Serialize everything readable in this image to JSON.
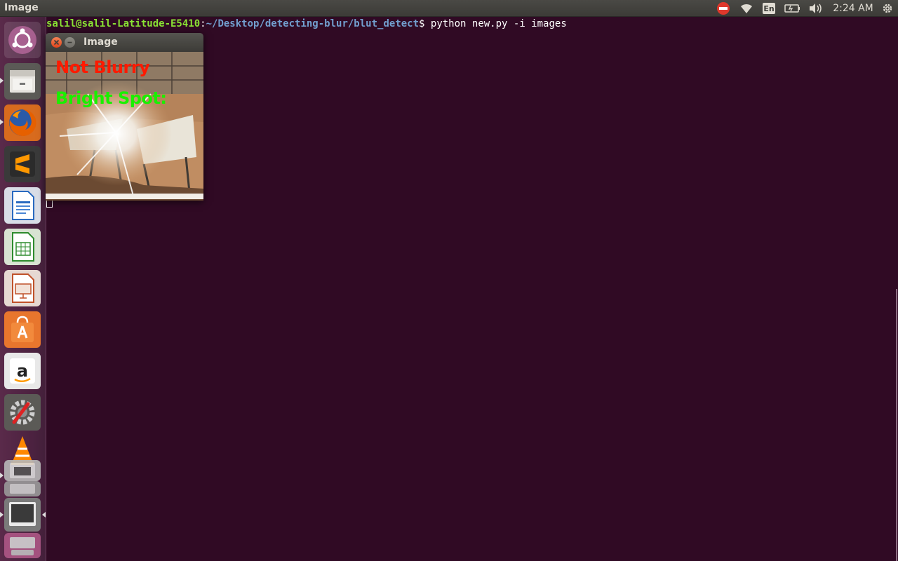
{
  "panel": {
    "title": "Image",
    "clock": "2:24 AM",
    "lang": "En"
  },
  "terminal": {
    "user_host": "salil@salil-Latitude-E5410",
    "separator": ":",
    "path": "~/Desktop/detecting-blur/blut_detect",
    "prompt_char": "$",
    "command": " python new.py -i images"
  },
  "image_window": {
    "title": "Image",
    "blur_label": "Not Blurry",
    "bright_label": "Bright Spot:"
  },
  "launcher": [
    {
      "name": "ubuntu-dash-icon"
    },
    {
      "name": "files-icon"
    },
    {
      "name": "firefox-icon"
    },
    {
      "name": "sublime-text-icon"
    },
    {
      "name": "libreoffice-writer-icon"
    },
    {
      "name": "libreoffice-calc-icon"
    },
    {
      "name": "libreoffice-impress-icon"
    },
    {
      "name": "software-center-icon"
    },
    {
      "name": "amazon-icon"
    },
    {
      "name": "system-settings-icon"
    },
    {
      "name": "vlc-icon"
    }
  ],
  "colors": {
    "terminal_bg": "#300a24",
    "prompt_user": "#8ae234",
    "prompt_path": "#729fcf",
    "blur_label": "#ff1a00",
    "bright_label": "#19f000"
  }
}
